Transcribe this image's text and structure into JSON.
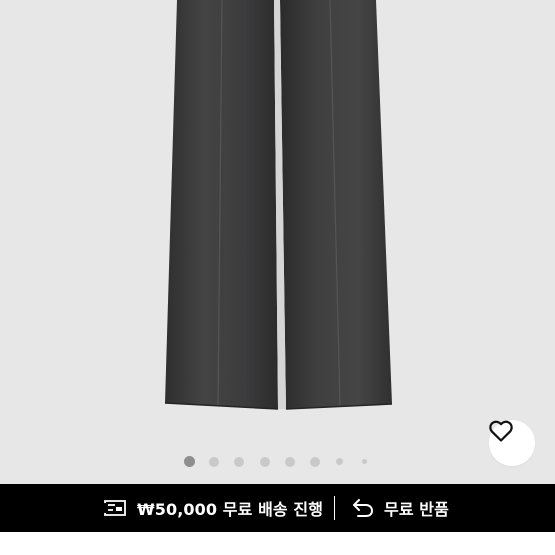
{
  "product": {
    "image_subject": "black wide-leg trousers",
    "background_color": "#e7e7e7",
    "garment_color": "#3f3f40"
  },
  "carousel": {
    "total_dots": 8,
    "active_index": 0
  },
  "wishlist": {
    "icon": "heart-icon"
  },
  "benefits": {
    "shipping_icon": "delivery-icon",
    "shipping_text": "₩50,000 무료 배송 진행",
    "return_icon": "return-arrow-icon",
    "return_text": "무료 반품"
  },
  "theme": {
    "bar_background": "#000000",
    "bar_text": "#ffffff",
    "dot_active": "#8e8e8e",
    "dot_inactive": "#c9c9c9"
  }
}
